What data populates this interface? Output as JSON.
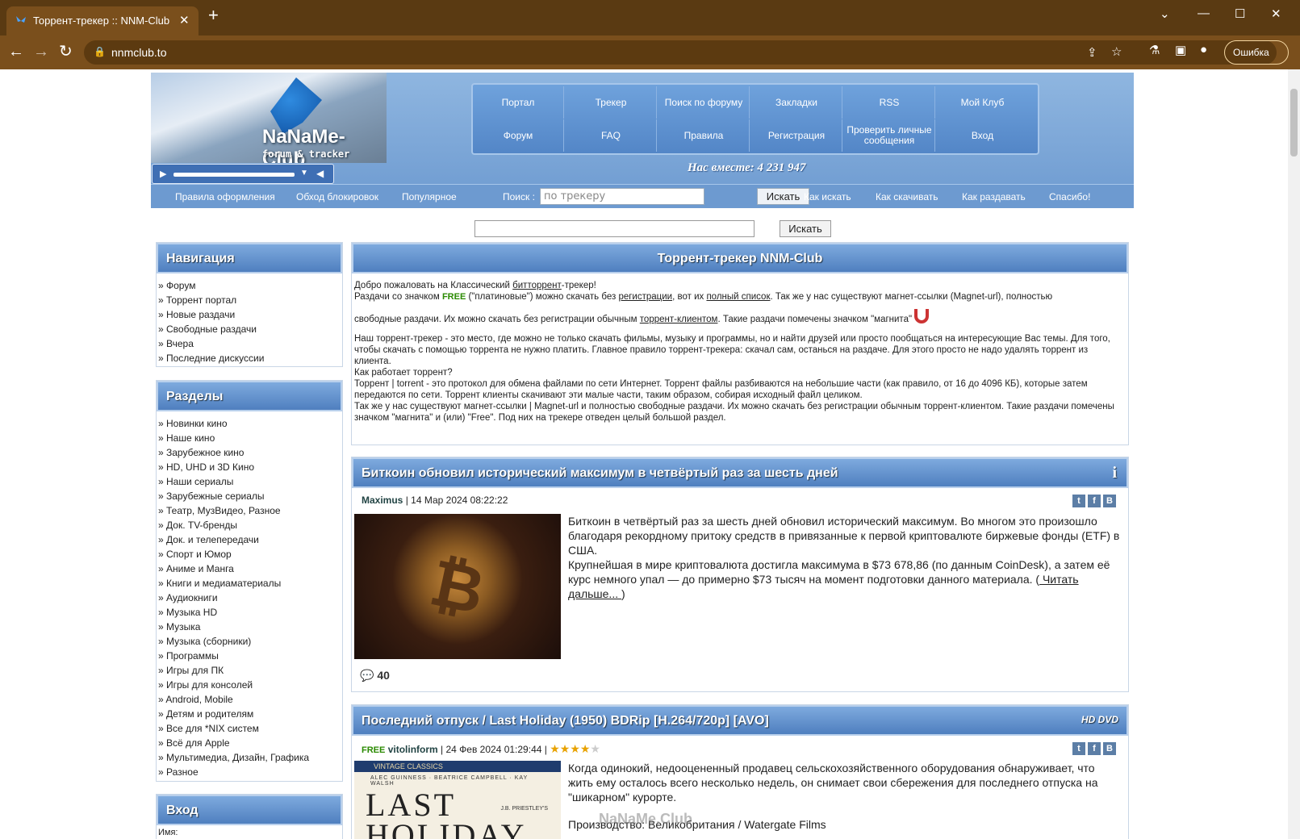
{
  "browser": {
    "tab_title": "Торрент-трекер :: NNM-Club",
    "url": "nnmclub.to",
    "error_label": "Ошибка"
  },
  "header": {
    "logo": "NaNaMe-Club",
    "logo_sub": "forum & tracker",
    "menu_row1": [
      "Портал",
      "Трекер",
      "Поиск по форуму",
      "Закладки",
      "RSS",
      "Мой Клуб"
    ],
    "menu_row2": [
      "Форум",
      "FAQ",
      "Правила",
      "Регистрация",
      "Проверить личные сообщения",
      "Вход"
    ],
    "members": "Нас вместе: 4 231 947",
    "links_left": [
      "Правила оформления",
      "Обход блокировок",
      "Популярное"
    ],
    "search_label": "Поиск :",
    "search_placeholder": "по трекеру",
    "search_button": "Искать",
    "links_right": [
      "Как искать",
      "Как скачивать",
      "Как раздавать",
      "Спасибо!"
    ]
  },
  "global_search": {
    "button": "Искать"
  },
  "nav": {
    "title": "Навигация",
    "items": [
      "» Форум",
      "» Торрент портал",
      "» Новые раздачи",
      "» Свободные раздачи",
      "» Вчера",
      "» Последние дискуссии"
    ]
  },
  "sections": {
    "title": "Разделы",
    "items": [
      "» Новинки кино",
      "» Наше кино",
      "» Зарубежное кино",
      "» HD, UHD и 3D Кино",
      "» Наши сериалы",
      "» Зарубежные сериалы",
      "» Театр, МузВидео, Разное",
      "» Док. TV-бренды",
      "» Док. и телепередачи",
      "» Спорт и Юмор",
      "» Аниме и Манга",
      "» Книги и медиаматериалы",
      "» Аудиокниги",
      "» Музыка HD",
      "» Музыка",
      "» Музыка (сборники)",
      "» Программы",
      "» Игры для ПК",
      "» Игры для консолей",
      "» Android, Mobile",
      "» Детям и родителям",
      "» Все для *NIX систем",
      "» Всё для Apple",
      "» Мультимедиа, Дизайн, Графика",
      "» Разное"
    ]
  },
  "login": {
    "title": "Вход",
    "name_label": "Имя:"
  },
  "welcome": {
    "title": "Торрент-трекер NNM-Club",
    "l1a": "Добро пожаловать на Классический ",
    "l1b": "битторрент",
    "l1c": "-трекер!",
    "l2a": "Раздачи со значком ",
    "l2free": "FREE",
    "l2b": " (\"платиновые\") можно скачать без ",
    "l2c": "регистрации",
    "l2d": ", вот их ",
    "l2e": "полный список",
    "l2f": ". Так же у нас существуют магнет-ссылки (Magnet-url), полностью",
    "l3a": "свободные раздачи. Их можно скачать без регистрации обычным ",
    "l3b": "торрент-клиентом",
    "l3c": ". Такие раздачи помечены значком \"магнита\"",
    "p2": "Наш торрент-трекер - это место, где можно не только скачать фильмы, музыку и программы, но и найти друзей или просто пообщаться на интересующие Вас темы. Для того, чтобы скачать с помощью торрента не нужно платить. Главное правило торрент-трекера: скачал сам, останься на раздаче. Для этого просто не надо удалять торрент из клиента.",
    "p3": "Как работает торрент?",
    "p4": "Торрент | torrent - это протокол для обмена файлами по сети Интернет. Торрент файлы разбиваются на небольшие части (как правило, от 16 до 4096 КБ), которые затем передаются по сети. Торрент клиенты скачивают эти малые части, таким образом, собирая исходный файл целиком.",
    "p5": "Так же у нас существуют магнет-ссылки | Magnet-url и полностью свободные раздачи. Их можно скачать без регистрации обычным торрент-клиентом. Такие раздачи помечены значком \"магнита\" и (или) \"Free\". Под них на трекере отведен целый большой раздел."
  },
  "news1": {
    "title": "Биткоин обновил исторический максимум в четвёртый раз за шесть дней",
    "author": "Maximus",
    "date": "| 14 Мар 2024 08:22:22",
    "t1": "Биткоин в четвёртый раз за шесть дней обновил исторический максимум. Во многом это произошло благодаря рекордному притоку средств в привязанные к первой криптовалюте биржевые фонды (ETF) в США.",
    "t2": "Крупнейшая в мире криптовалюта достигла максимума в $73 678,86 (по данным CoinDesk), а затем её курс немного упал — до примерно $73 тысяч на момент подготовки данного материала. (",
    "read_more": " Читать дальше... ",
    "close": ")",
    "comments": "40"
  },
  "news2": {
    "title": "Последний отпуск / Last Holiday (1950) BDRip [H.264/720p] [AVO]",
    "free": "FREE",
    "author": "vitolinform",
    "date": "| 24 Фев 2024 01:29:44 |",
    "stars": "★★★★",
    "star_off": "★",
    "t1": "Когда одинокий, недооцененный продавец сельскохозяйственного оборудования обнаруживает, что жить ему осталось всего несколько недель, он снимает свои сбережения для последнего отпуска на \"шикарном\" курорте.",
    "t2": "Производство: Великобритания / Watergate Films",
    "badge": "HD DVD",
    "poster_top": "VINTAGE CLASSICS",
    "poster_cast": "ALEC GUINNESS · BEATRICE CAMPBELL · KAY WALSH",
    "poster_author": "J.B. PRIESTLEY'S",
    "poster_title": "LAST HOLIDAY",
    "watermark": "NaNaMe.Club"
  }
}
